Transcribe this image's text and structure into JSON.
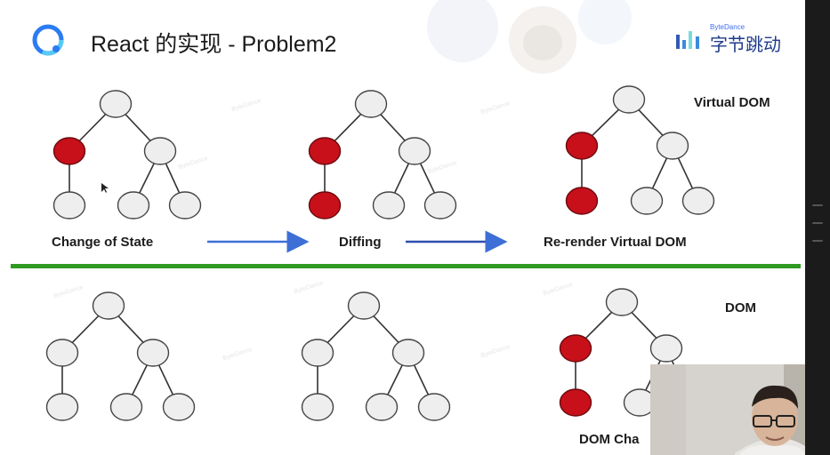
{
  "slide": {
    "title": "React 的实现 - Problem2",
    "brand": {
      "small": "ByteDance",
      "name": "字节跳动"
    }
  },
  "top_section": {
    "section_label": "Virtual DOM",
    "steps": [
      {
        "label": "Change of State"
      },
      {
        "label": "Diffing"
      },
      {
        "label": "Re-render Virtual DOM"
      }
    ]
  },
  "bottom_section": {
    "section_label": "DOM",
    "caption_partial": "DOM Cha"
  },
  "colors": {
    "changed_node": "#c8101a",
    "normal_node": "#eeeeee",
    "divider": "#2e9a22",
    "arrow": "#3d6fd6"
  },
  "icons": {
    "logo": "app-logo-icon",
    "brand": "bytedance-logo-icon",
    "webcam": "presenter-video-feed"
  }
}
